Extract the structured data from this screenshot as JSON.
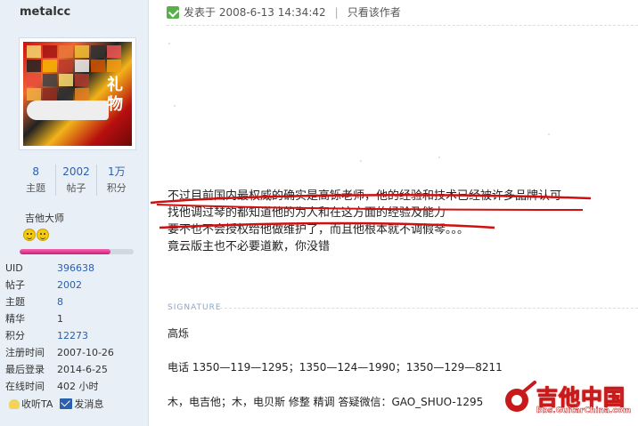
{
  "author": {
    "username": "metalcc",
    "avatar_caption": "礼物",
    "stats": [
      {
        "value": "8",
        "label": "主题"
      },
      {
        "value": "2002",
        "label": "帖子"
      },
      {
        "value": "1万",
        "label": "积分"
      }
    ],
    "rank_title": "吉他大师",
    "rank_progress_percent": 80,
    "info": [
      {
        "key": "UID",
        "value": "396638"
      },
      {
        "key": "帖子",
        "value": "2002"
      },
      {
        "key": "主题",
        "value": "8"
      },
      {
        "key": "精华",
        "value": "1"
      },
      {
        "key": "积分",
        "value": "12273"
      },
      {
        "key": "注册时间",
        "value": "2007-10-26"
      },
      {
        "key": "最后登录",
        "value": "2014-6-25"
      },
      {
        "key": "在线时间",
        "value": "402 小时"
      }
    ],
    "actions": {
      "listen": "收听TA",
      "message": "发消息"
    }
  },
  "post": {
    "posted_at": "发表于 2008-6-13 14:34:42",
    "author_only": "只看该作者",
    "lines": [
      "不过目前国内最权威的确实是高铄老师，他的经验和技术已经被许多品牌认可",
      "找他调过琴的都知道他的为人和在这方面的经验及能力",
      "要不也不会授权给他做维护了，而且他根本就不调假琴。。。",
      "竟云版主也不必要道歉，你没错"
    ],
    "signature": {
      "label": "SIGNATURE",
      "name": "高烁",
      "phone": "电话 1350—119—1295；1350—124—1990；1350—129—8211",
      "footer": "木，电吉他；木，电贝斯   修整   精调   答疑微信：GAO_SHUO-1295"
    }
  },
  "watermark": {
    "title": "吉他中国",
    "url": "bbs.GuitarChina.com"
  },
  "colors": {
    "sidebar_bg": "#e9eff6",
    "link": "#2a60b0",
    "annotation_red": "#d01010"
  }
}
